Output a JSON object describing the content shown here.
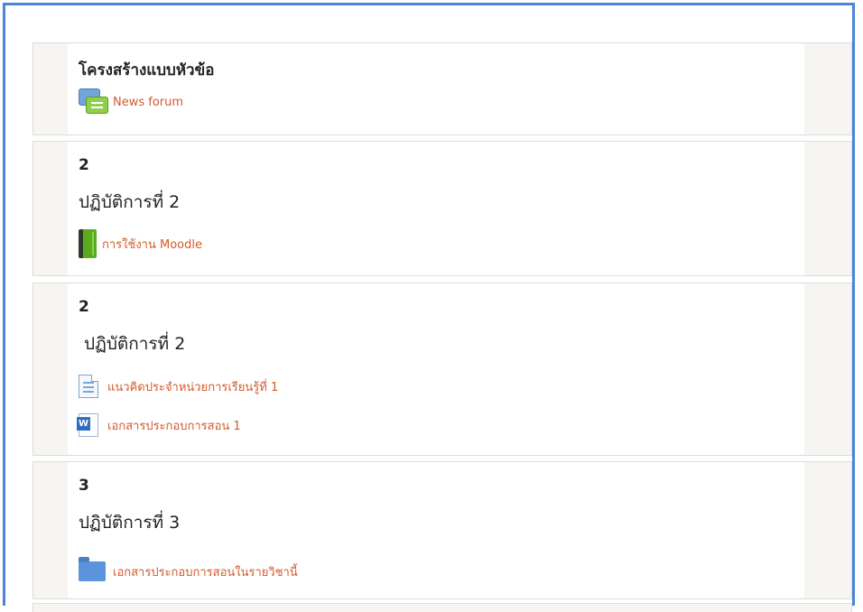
{
  "sections": [
    {
      "title": "โครงสร้างแบบหัวข้อ",
      "summary": "",
      "activities": [
        {
          "icon": "forum-icon",
          "label": "News forum"
        }
      ]
    },
    {
      "title": "2",
      "summary": "ปฏิบัติการที่ 2",
      "activities": [
        {
          "icon": "book-icon",
          "label": "การใช้งาน Moodle"
        }
      ]
    },
    {
      "title": "2",
      "summary": " ปฏิบัติการที่ 2",
      "activities": [
        {
          "icon": "page-icon",
          "label": "แนวคิดประจำหน่วยการเรียนรู้ที่ 1"
        },
        {
          "icon": "word-document-icon",
          "label": "เอกสารประกอบการสอน 1"
        }
      ]
    },
    {
      "title": "3",
      "summary": "ปฏิบัติการที่ 3",
      "activities": [
        {
          "icon": "folder-icon",
          "label": "เอกสารประกอบการสอนในรายวิชานี้"
        }
      ]
    }
  ],
  "colors": {
    "frame_border": "#4a86d4",
    "link": "#d35a2c",
    "section_side": "#f6f5f2"
  }
}
